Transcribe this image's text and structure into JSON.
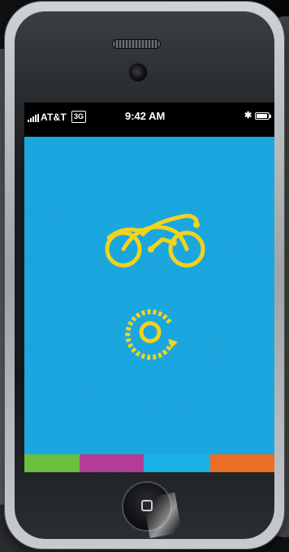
{
  "status_bar": {
    "carrier": "AT&T",
    "network": "3G",
    "time": "9:42 AM",
    "bluetooth_icon": "bluetooth-icon",
    "battery_level": 0.9
  },
  "map": {
    "labels": []
  },
  "logo": {
    "icon": "bicycle-logo-icon",
    "color": "#f2d31b"
  },
  "action": {
    "icon": "rotate-target-icon",
    "color": "#f2d31b"
  },
  "tabbar": {
    "tabs": [
      {
        "color": "#6bbf3f",
        "weight": 66
      },
      {
        "color": "#b13d96",
        "weight": 77
      },
      {
        "color": "#19b1e6",
        "weight": 80
      },
      {
        "color": "#ec6d24",
        "weight": 77
      }
    ]
  },
  "colors": {
    "screen_bg": "#1aa7df",
    "map_lines": "#2a9bd2",
    "accent_yellow": "#f2d31b"
  }
}
